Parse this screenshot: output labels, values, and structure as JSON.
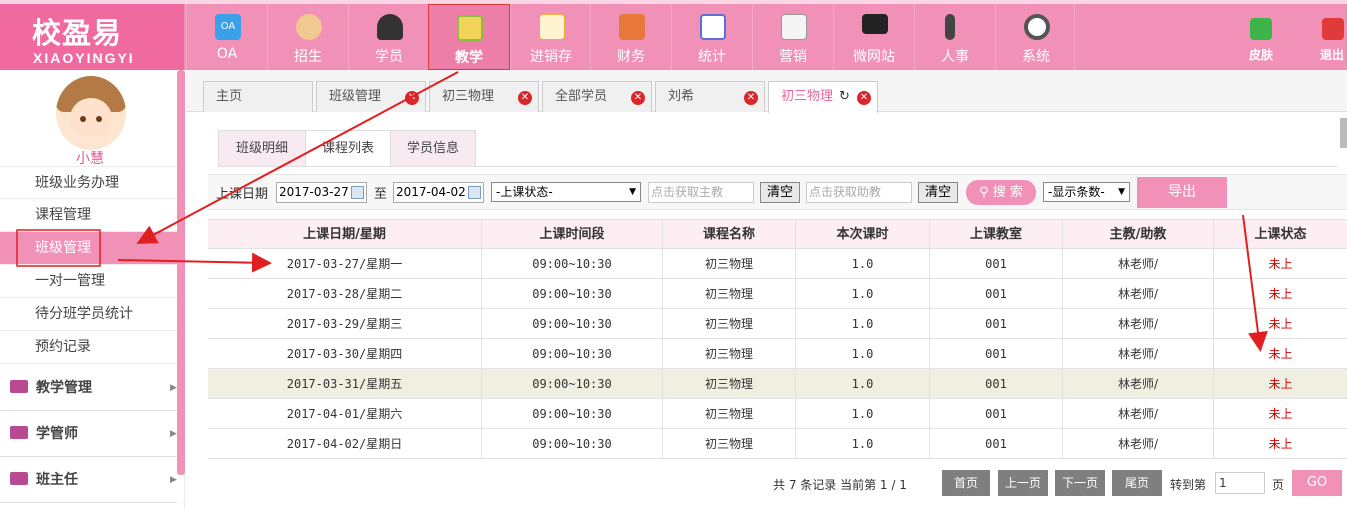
{
  "logo": {
    "cn": "校盈易",
    "en": "XIAOYINGYI"
  },
  "nav": [
    {
      "label": "OA",
      "icon": "oa-icon",
      "color": "#3aa0e8"
    },
    {
      "label": "招生",
      "icon": "enroll-icon",
      "color": "#e88a2f"
    },
    {
      "label": "学员",
      "icon": "student-icon",
      "color": "#333333"
    },
    {
      "label": "教学",
      "icon": "teaching-icon",
      "color": "#8bbf3c"
    },
    {
      "label": "进销存",
      "icon": "inventory-icon",
      "color": "#e8b23a"
    },
    {
      "label": "财务",
      "icon": "finance-icon",
      "color": "#e8773a"
    },
    {
      "label": "统计",
      "icon": "stats-icon",
      "color": "#5b6fd6"
    },
    {
      "label": "营销",
      "icon": "marketing-icon",
      "color": "#f5f5f5"
    },
    {
      "label": "微网站",
      "icon": "microsite-icon",
      "color": "#222222"
    },
    {
      "label": "人事",
      "icon": "hr-icon",
      "color": "#444444"
    },
    {
      "label": "系统",
      "icon": "system-gear-icon",
      "color": "#555555"
    }
  ],
  "header_right": {
    "skin": "皮肤",
    "logout": "退出"
  },
  "user": {
    "name": "小慧"
  },
  "sidebar": {
    "items": [
      "班级业务办理",
      "课程管理",
      "班级管理",
      "一对一管理",
      "待分班学员统计",
      "预约记录"
    ],
    "groups": [
      "教学管理",
      "学管师",
      "班主任"
    ]
  },
  "tabs": [
    "主页",
    "班级管理",
    "初三物理",
    "全部学员",
    "刘希",
    "初三物理"
  ],
  "subtabs": [
    "班级明细",
    "课程列表",
    "学员信息"
  ],
  "filter": {
    "date_label": "上课日期",
    "start_date": "2017-03-27",
    "to": "至",
    "end_date": "2017-04-02",
    "status_select": "-上课状态-",
    "teacher_placeholder": "点击获取主教",
    "clear": "清空",
    "assistant_placeholder": "点击获取助教",
    "search": "搜 索",
    "count_select": "-显示条数-",
    "export": "导出"
  },
  "table": {
    "headers": [
      "上课日期/星期",
      "上课时间段",
      "课程名称",
      "本次课时",
      "上课教室",
      "主教/助教",
      "上课状态"
    ],
    "rows": [
      [
        "2017-03-27/星期一",
        "09:00~10:30",
        "初三物理",
        "1.0",
        "001",
        "林老师/",
        "未上"
      ],
      [
        "2017-03-28/星期二",
        "09:00~10:30",
        "初三物理",
        "1.0",
        "001",
        "林老师/",
        "未上"
      ],
      [
        "2017-03-29/星期三",
        "09:00~10:30",
        "初三物理",
        "1.0",
        "001",
        "林老师/",
        "未上"
      ],
      [
        "2017-03-30/星期四",
        "09:00~10:30",
        "初三物理",
        "1.0",
        "001",
        "林老师/",
        "未上"
      ],
      [
        "2017-03-31/星期五",
        "09:00~10:30",
        "初三物理",
        "1.0",
        "001",
        "林老师/",
        "未上"
      ],
      [
        "2017-04-01/星期六",
        "09:00~10:30",
        "初三物理",
        "1.0",
        "001",
        "林老师/",
        "未上"
      ],
      [
        "2017-04-02/星期日",
        "09:00~10:30",
        "初三物理",
        "1.0",
        "001",
        "林老师/",
        "未上"
      ]
    ]
  },
  "pager": {
    "summary": "共 7 条记录 当前第 1 / 1",
    "first": "首页",
    "prev": "上一页",
    "next": "下一页",
    "last": "尾页",
    "goto_label": "转到第",
    "goto_value": "1",
    "page_unit": "页",
    "go": "GO"
  },
  "colors": {
    "brand_pink": "#f291b8",
    "status_red": "#d80000",
    "annotation_red": "#e02020"
  }
}
